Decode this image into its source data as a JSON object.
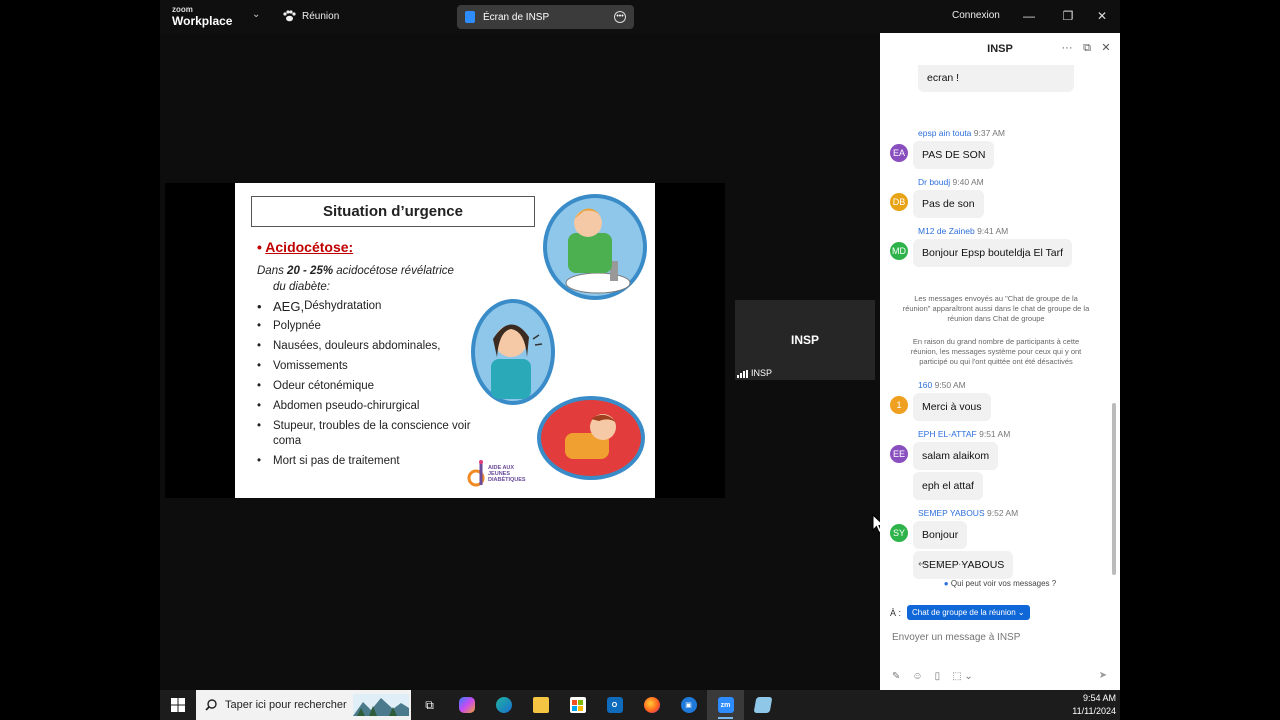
{
  "titlebar": {
    "logo_top": "zoom",
    "logo_bottom": "Workplace",
    "meeting_label": "Réunion",
    "share_label": "Écran de INSP",
    "login_label": "Connexion"
  },
  "slide": {
    "title": "Situation d’urgence",
    "heading": "Acidocétose:",
    "intro_pre": "Dans ",
    "intro_bold": "20 - 25%",
    "intro_post": " acidocétose révélatrice",
    "intro_line2": "du diabète:",
    "items": [
      {
        "main": "AEG, ",
        "rest": "Déshydratation"
      },
      {
        "main": "Polypnée",
        "rest": ""
      },
      {
        "main": "Nausées, douleurs abdominales,",
        "rest": ""
      },
      {
        "main": " Vomissements",
        "rest": ""
      },
      {
        "main": "Odeur cétonémique",
        "rest": ""
      },
      {
        "main": " Abdomen pseudo-chirurgical",
        "rest": ""
      },
      {
        "main": "Stupeur, troubles de la conscience voir coma",
        "rest": ""
      },
      {
        "main": " Mort si pas de traitement",
        "rest": ""
      }
    ],
    "logo_text": "AIDE AUX JEUNES DIABÉTIQUES"
  },
  "participant": {
    "name": "INSP",
    "label": "INSP"
  },
  "chat": {
    "title": "INSP",
    "partial_message": "ecran !",
    "messages": [
      {
        "initials": "EA",
        "color": "#8a4fbf",
        "sender": "epsp ain touta",
        "time": "9:37 AM",
        "texts": [
          "PAS DE SON"
        ]
      },
      {
        "initials": "DB",
        "color": "#e8a317",
        "sender": "Dr boudj",
        "time": "9:40 AM",
        "texts": [
          "Pas de son"
        ]
      },
      {
        "initials": "MD",
        "color": "#2db34a",
        "sender": "M12 de Zaineb",
        "time": "9:41 AM",
        "texts": [
          "Bonjour Epsp bouteldja El Tarf"
        ]
      },
      {
        "initials": "1",
        "color": "#f0a020",
        "sender": "160",
        "time": "9:50 AM",
        "texts": [
          "Merci à vous"
        ]
      },
      {
        "initials": "EE",
        "color": "#8a4fbf",
        "sender": "EPH EL-ATTAF",
        "time": "9:51 AM",
        "texts": [
          "salam alaikom",
          "eph el attaf"
        ]
      },
      {
        "initials": "SY",
        "color": "#2db34a",
        "sender": "SEMEP YABOUS",
        "time": "9:52 AM",
        "texts": [
          "Bonjour",
          "SEMEP YABOUS"
        ]
      }
    ],
    "system_notes": [
      "Les messages envoyés au \"Chat de groupe de la réunion\" apparaîtront aussi dans le chat de groupe de la réunion dans Chat de groupe",
      "En raison du grand nombre de participants à cette réunion, les messages système pour ceux qui y ont participé ou qui l'ont quittée ont été désactivés"
    ],
    "privacy": "Qui peut voir vos messages ?",
    "to_label": "À :",
    "to_chip": "Chat de groupe de la réunion",
    "composer_placeholder": "Envoyer un message à INSP"
  },
  "taskbar": {
    "search_placeholder": "Taper ici pour rechercher",
    "time": "9:54 AM",
    "date": "11/11/2024"
  }
}
